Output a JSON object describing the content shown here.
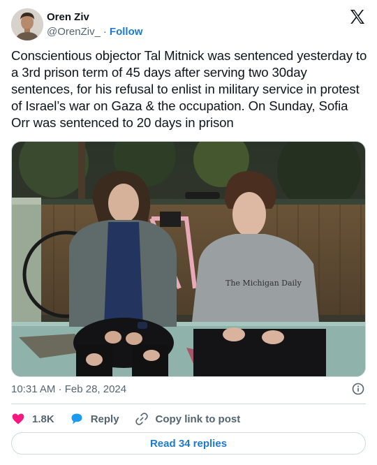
{
  "author": {
    "name": "Oren Ziv",
    "handle": "@OrenZiv_",
    "separator": "·",
    "follow_label": "Follow"
  },
  "tweet": {
    "text": "Conscientious objector Tal Mitnick was sentenced yesterday to a 3rd prison term of 45 days after serving two 30day sentences, for his refusal to enlist in military service in protest of Israel’s war on Gaza & the occupation. On Sunday, Sofia Orr was sentenced to 20 days in prison",
    "timestamp": "10:31 AM · Feb 28, 2024",
    "photo_sweatshirt_text": "The Michigan Daily"
  },
  "actions": {
    "likes_count": "1.8K",
    "reply_label": "Reply",
    "copy_link_label": "Copy link to post"
  },
  "footer": {
    "read_replies_label": "Read 34 replies"
  },
  "icons": {
    "brand": "x-logo-icon",
    "info": "info-icon",
    "like": "heart-icon",
    "reply": "speech-bubble-icon",
    "copy": "link-icon"
  },
  "colors": {
    "accent": "#1d7ad0",
    "heart": "#f91880",
    "muted": "#536471",
    "border": "#cfd9de"
  }
}
